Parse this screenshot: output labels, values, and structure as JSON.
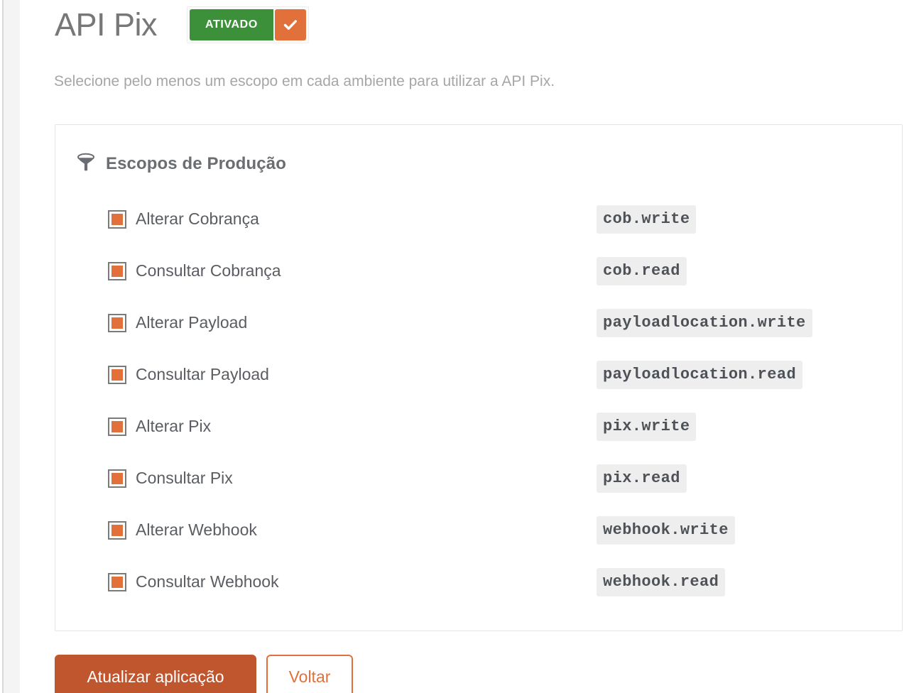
{
  "header": {
    "title": "API Pix",
    "toggle": {
      "label": "ATIVADO",
      "check_icon": "check-icon",
      "on_color": "#3c9039",
      "check_color": "#e2703a"
    }
  },
  "subtitle": "Selecione pelo menos um escopo em cada ambiente para utilizar a API Pix.",
  "panel": {
    "icon": "funnel-icon",
    "title": "Escopos de Produção",
    "scopes": [
      {
        "label": "Alterar Cobrança",
        "code": "cob.write",
        "checked": true
      },
      {
        "label": "Consultar Cobrança",
        "code": "cob.read",
        "checked": true
      },
      {
        "label": "Alterar Payload",
        "code": "payloadlocation.write",
        "checked": true
      },
      {
        "label": "Consultar Payload",
        "code": "payloadlocation.read",
        "checked": true
      },
      {
        "label": "Alterar Pix",
        "code": "pix.write",
        "checked": true
      },
      {
        "label": "Consultar Pix",
        "code": "pix.read",
        "checked": true
      },
      {
        "label": "Alterar Webhook",
        "code": "webhook.write",
        "checked": true
      },
      {
        "label": "Consultar Webhook",
        "code": "webhook.read",
        "checked": true
      }
    ]
  },
  "actions": {
    "primary_label": "Atualizar aplicação",
    "secondary_label": "Voltar",
    "primary_color": "#c0562e",
    "secondary_color": "#e2703a"
  }
}
